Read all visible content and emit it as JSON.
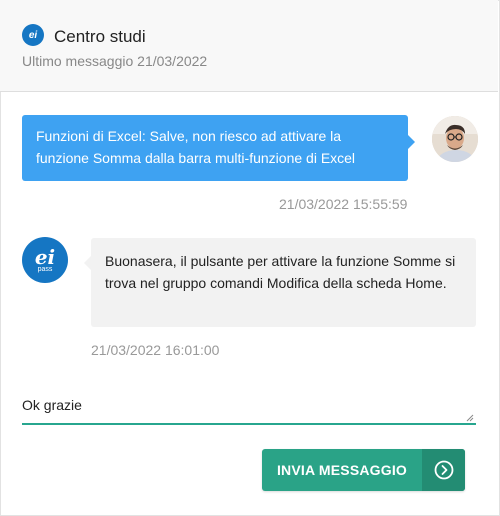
{
  "header": {
    "logo_text": "ei",
    "title": "Centro studi",
    "subtitle": "Ultimo messaggio 21/03/2022"
  },
  "messages": [
    {
      "direction": "outgoing",
      "text": "Funzioni di Excel: Salve, non riesco ad attivare la funzione Somma dalla barra multi-funzione di Excel",
      "timestamp": "21/03/2022 15:55:59",
      "bubble_color": "#3ea2f2"
    },
    {
      "direction": "incoming",
      "text": "Buonasera, il pulsante per attivare la funzione Somme si trova nel gruppo comandi Modifica della scheda Home.",
      "timestamp": "21/03/2022 16:01:00",
      "bubble_color": "#f2f2f2",
      "avatar_logo": {
        "main": "ei",
        "sub": "pass"
      }
    }
  ],
  "reply": {
    "value": "Ok grazie",
    "underline_color": "#27a68f"
  },
  "send_button": {
    "label": "INVIA MESSAGGIO",
    "icon": "chevron-right-circle-icon",
    "color": "#2aa387"
  }
}
